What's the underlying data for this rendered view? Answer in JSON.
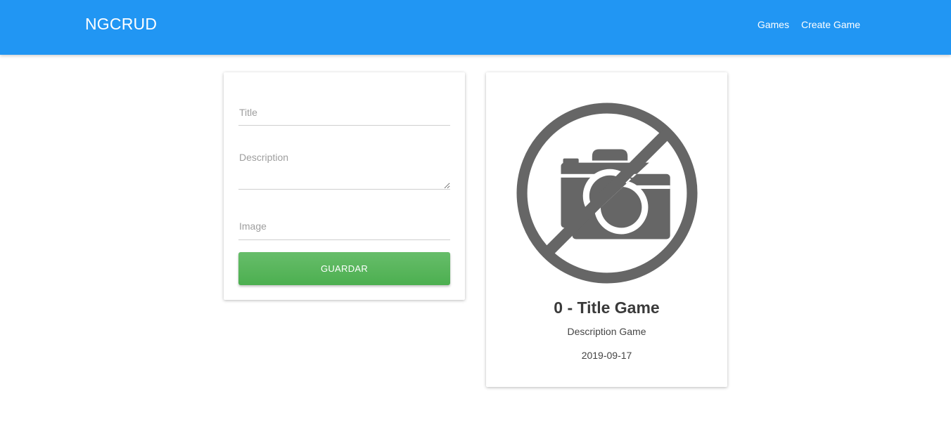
{
  "navbar": {
    "brand": "NGCRUD",
    "links": [
      {
        "label": "Games"
      },
      {
        "label": "Create Game"
      }
    ],
    "color": "#2196f3"
  },
  "form": {
    "title_placeholder": "Title",
    "description_placeholder": "Description",
    "image_placeholder": "Image",
    "save_label": "GUARDAR",
    "save_color": "#4caf50"
  },
  "game": {
    "image_icon": "no-photo-icon",
    "title": "0 - Title Game",
    "description": "Description Game",
    "date": "2019-09-17"
  }
}
